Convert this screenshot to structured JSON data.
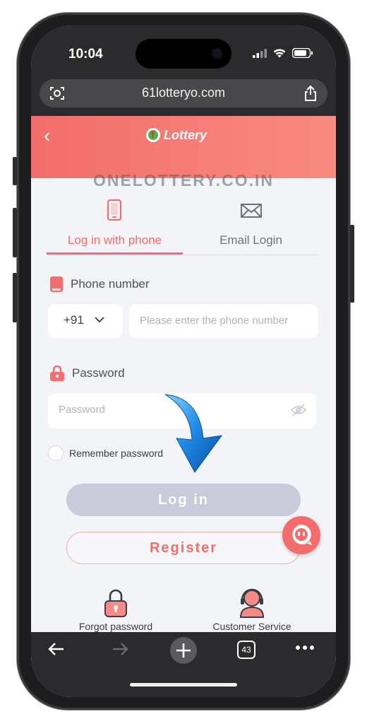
{
  "status_bar": {
    "time": "10:04"
  },
  "browser": {
    "url": "61lotteryo.com",
    "tab_count": "43"
  },
  "header": {
    "back_label": "‹",
    "logo_text": "Lottery"
  },
  "watermark": "ONELOTTERY.CO.IN",
  "tabs": [
    {
      "label": "Log in with phone",
      "icon": "phone-icon",
      "active": true
    },
    {
      "label": "Email Login",
      "icon": "email-icon",
      "active": false
    }
  ],
  "phone": {
    "label": "Phone number",
    "country_code": "+91",
    "placeholder": "Please enter the phone number"
  },
  "password": {
    "label": "Password",
    "placeholder": "Password"
  },
  "remember_label": "Remember password",
  "buttons": {
    "login": "Log in",
    "register": "Register"
  },
  "footer": {
    "forgot": "Forgot password",
    "service": "Customer Service"
  },
  "colors": {
    "accent": "#f26d6b",
    "login_disabled": "#c9cbdb",
    "background": "#f3f4f8"
  }
}
